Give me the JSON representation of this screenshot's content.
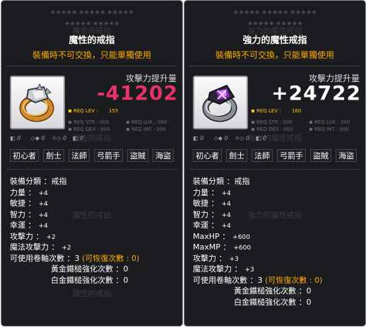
{
  "stars": "★★★★★ ★★★★★ ★★★★★",
  "common": {
    "trade_restriction": "裝備時不可交換，只能單獨使用",
    "attack_increase_label": "攻擊力提升量",
    "req_lev_label": "REQ LEV :",
    "req_stats": [
      "REQ STR :",
      "REQ LUK :",
      "REQ DEX :",
      "REQ INT :"
    ],
    "req_stat_value": "000",
    "slot_labels": [
      "◧",
      "◇◆",
      "☼◇",
      "◧"
    ],
    "slot_value": "0",
    "jobs": [
      "初心者",
      "劍士",
      "法師",
      "弓箭手",
      "盜賊",
      "海盜"
    ],
    "category_label": "裝備分類 ：",
    "category_value": "戒指",
    "gold_hammer_label": "黃金鐵槌強化次數 ：",
    "platinum_hammer_label": "白金鐵槌強化次數 ："
  },
  "left": {
    "title": "魔性的戒指",
    "ghost_title": "魔性的戒指",
    "attack_change": "-41202",
    "attack_color": "#e8336a",
    "req_lev": "155",
    "stats": [
      {
        "label": "力量 ：",
        "value": "+4"
      },
      {
        "label": "敏捷 ：",
        "value": "+4"
      },
      {
        "label": "智力 ：",
        "value": "+4"
      },
      {
        "label": "幸運 ：",
        "value": "+4"
      },
      {
        "label": "攻擊力 ：",
        "value": "+2"
      },
      {
        "label": "魔法攻擊力 ：",
        "value": "+2"
      }
    ],
    "scroll_label": "可使用卷軸次數 ：",
    "scroll_value": "3",
    "scroll_restore": "(可恢復次數 : 0)",
    "gold_hammer_value": "0",
    "platinum_hammer_value": "0"
  },
  "right": {
    "title": "強力的魔性戒指",
    "ghost_title": "強力的魔性戒指",
    "attack_change": "+24722",
    "attack_color": "#ffffff",
    "req_lev": "160",
    "stats": [
      {
        "label": "力量 ：",
        "value": "+4"
      },
      {
        "label": "敏捷 ：",
        "value": "+4"
      },
      {
        "label": "智力 ：",
        "value": "+4"
      },
      {
        "label": "幸運 ：",
        "value": "+4"
      },
      {
        "label": "MaxHP ：",
        "value": "+600"
      },
      {
        "label": "MaxMP ：",
        "value": "+600"
      },
      {
        "label": "攻擊力 ：",
        "value": "+3"
      },
      {
        "label": "魔法攻擊力 ：",
        "value": "+3"
      }
    ],
    "scroll_label": "可使用卷軸次數 ：",
    "scroll_value": "3",
    "scroll_restore": "(可恢復次數 : 0)",
    "gold_hammer_value": "0",
    "platinum_hammer_value": "0"
  },
  "colors": {
    "accent_orange": "#ffaa00",
    "req_yellow": "#ffcc00",
    "panel_bg": "#1b1c1f"
  },
  "icons": {
    "left_item": "gold-silver-ring-icon",
    "right_item": "purple-gem-ring-icon"
  }
}
